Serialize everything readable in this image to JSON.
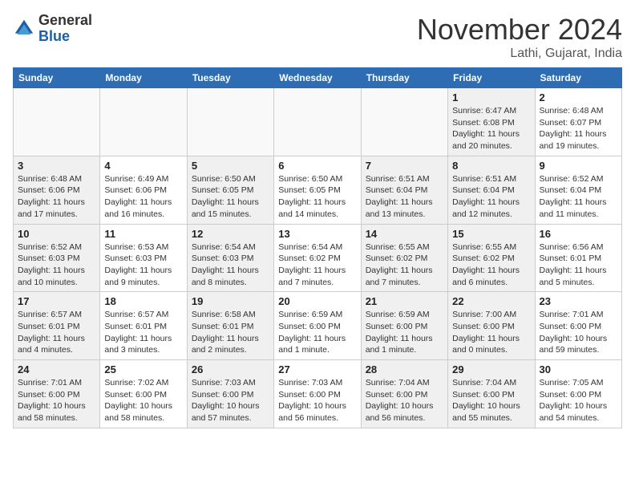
{
  "header": {
    "logo_general": "General",
    "logo_blue": "Blue",
    "month_title": "November 2024",
    "location": "Lathi, Gujarat, India"
  },
  "weekdays": [
    "Sunday",
    "Monday",
    "Tuesday",
    "Wednesday",
    "Thursday",
    "Friday",
    "Saturday"
  ],
  "weeks": [
    [
      {
        "day": "",
        "info": "",
        "empty": true
      },
      {
        "day": "",
        "info": "",
        "empty": true
      },
      {
        "day": "",
        "info": "",
        "empty": true
      },
      {
        "day": "",
        "info": "",
        "empty": true
      },
      {
        "day": "",
        "info": "",
        "empty": true
      },
      {
        "day": "1",
        "info": "Sunrise: 6:47 AM\nSunset: 6:08 PM\nDaylight: 11 hours and 20 minutes.",
        "shaded": true
      },
      {
        "day": "2",
        "info": "Sunrise: 6:48 AM\nSunset: 6:07 PM\nDaylight: 11 hours and 19 minutes."
      }
    ],
    [
      {
        "day": "3",
        "info": "Sunrise: 6:48 AM\nSunset: 6:06 PM\nDaylight: 11 hours and 17 minutes.",
        "shaded": true
      },
      {
        "day": "4",
        "info": "Sunrise: 6:49 AM\nSunset: 6:06 PM\nDaylight: 11 hours and 16 minutes."
      },
      {
        "day": "5",
        "info": "Sunrise: 6:50 AM\nSunset: 6:05 PM\nDaylight: 11 hours and 15 minutes.",
        "shaded": true
      },
      {
        "day": "6",
        "info": "Sunrise: 6:50 AM\nSunset: 6:05 PM\nDaylight: 11 hours and 14 minutes."
      },
      {
        "day": "7",
        "info": "Sunrise: 6:51 AM\nSunset: 6:04 PM\nDaylight: 11 hours and 13 minutes.",
        "shaded": true
      },
      {
        "day": "8",
        "info": "Sunrise: 6:51 AM\nSunset: 6:04 PM\nDaylight: 11 hours and 12 minutes.",
        "shaded": true
      },
      {
        "day": "9",
        "info": "Sunrise: 6:52 AM\nSunset: 6:04 PM\nDaylight: 11 hours and 11 minutes."
      }
    ],
    [
      {
        "day": "10",
        "info": "Sunrise: 6:52 AM\nSunset: 6:03 PM\nDaylight: 11 hours and 10 minutes.",
        "shaded": true
      },
      {
        "day": "11",
        "info": "Sunrise: 6:53 AM\nSunset: 6:03 PM\nDaylight: 11 hours and 9 minutes."
      },
      {
        "day": "12",
        "info": "Sunrise: 6:54 AM\nSunset: 6:03 PM\nDaylight: 11 hours and 8 minutes.",
        "shaded": true
      },
      {
        "day": "13",
        "info": "Sunrise: 6:54 AM\nSunset: 6:02 PM\nDaylight: 11 hours and 7 minutes."
      },
      {
        "day": "14",
        "info": "Sunrise: 6:55 AM\nSunset: 6:02 PM\nDaylight: 11 hours and 7 minutes.",
        "shaded": true
      },
      {
        "day": "15",
        "info": "Sunrise: 6:55 AM\nSunset: 6:02 PM\nDaylight: 11 hours and 6 minutes.",
        "shaded": true
      },
      {
        "day": "16",
        "info": "Sunrise: 6:56 AM\nSunset: 6:01 PM\nDaylight: 11 hours and 5 minutes."
      }
    ],
    [
      {
        "day": "17",
        "info": "Sunrise: 6:57 AM\nSunset: 6:01 PM\nDaylight: 11 hours and 4 minutes.",
        "shaded": true
      },
      {
        "day": "18",
        "info": "Sunrise: 6:57 AM\nSunset: 6:01 PM\nDaylight: 11 hours and 3 minutes."
      },
      {
        "day": "19",
        "info": "Sunrise: 6:58 AM\nSunset: 6:01 PM\nDaylight: 11 hours and 2 minutes.",
        "shaded": true
      },
      {
        "day": "20",
        "info": "Sunrise: 6:59 AM\nSunset: 6:00 PM\nDaylight: 11 hours and 1 minute."
      },
      {
        "day": "21",
        "info": "Sunrise: 6:59 AM\nSunset: 6:00 PM\nDaylight: 11 hours and 1 minute.",
        "shaded": true
      },
      {
        "day": "22",
        "info": "Sunrise: 7:00 AM\nSunset: 6:00 PM\nDaylight: 11 hours and 0 minutes.",
        "shaded": true
      },
      {
        "day": "23",
        "info": "Sunrise: 7:01 AM\nSunset: 6:00 PM\nDaylight: 10 hours and 59 minutes."
      }
    ],
    [
      {
        "day": "24",
        "info": "Sunrise: 7:01 AM\nSunset: 6:00 PM\nDaylight: 10 hours and 58 minutes.",
        "shaded": true
      },
      {
        "day": "25",
        "info": "Sunrise: 7:02 AM\nSunset: 6:00 PM\nDaylight: 10 hours and 58 minutes."
      },
      {
        "day": "26",
        "info": "Sunrise: 7:03 AM\nSunset: 6:00 PM\nDaylight: 10 hours and 57 minutes.",
        "shaded": true
      },
      {
        "day": "27",
        "info": "Sunrise: 7:03 AM\nSunset: 6:00 PM\nDaylight: 10 hours and 56 minutes."
      },
      {
        "day": "28",
        "info": "Sunrise: 7:04 AM\nSunset: 6:00 PM\nDaylight: 10 hours and 56 minutes.",
        "shaded": true
      },
      {
        "day": "29",
        "info": "Sunrise: 7:04 AM\nSunset: 6:00 PM\nDaylight: 10 hours and 55 minutes.",
        "shaded": true
      },
      {
        "day": "30",
        "info": "Sunrise: 7:05 AM\nSunset: 6:00 PM\nDaylight: 10 hours and 54 minutes."
      }
    ]
  ]
}
